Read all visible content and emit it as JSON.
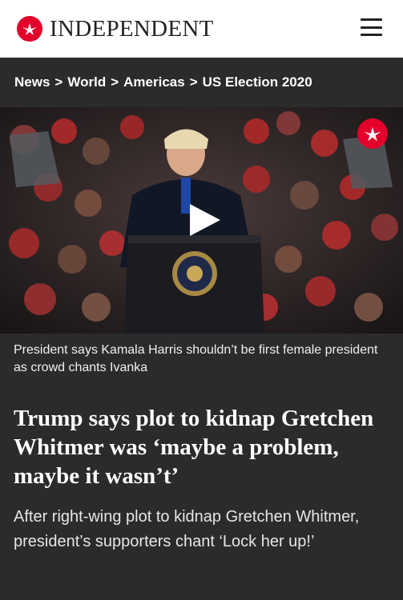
{
  "header": {
    "brand": "INDEPENDENT",
    "logo_icon": "eagle-icon",
    "menu_icon": "hamburger-menu-icon",
    "accent_color": "#e3002b"
  },
  "breadcrumb": {
    "items": [
      "News",
      "World",
      "Americas",
      "US Election 2020"
    ],
    "separator": ">"
  },
  "video": {
    "play_icon": "play-icon",
    "badge_icon": "eagle-icon",
    "caption": "President says Kamala Harris shouldn’t be first female president as crowd chants Ivanka"
  },
  "article": {
    "headline": "Trump says plot to kidnap Gretchen Whitmer was ‘maybe a problem, maybe it wasn’t’",
    "standfirst": "After right-wing plot to kidnap Gretchen Whitmer, president’s supporters chant ‘Lock her up!’"
  }
}
